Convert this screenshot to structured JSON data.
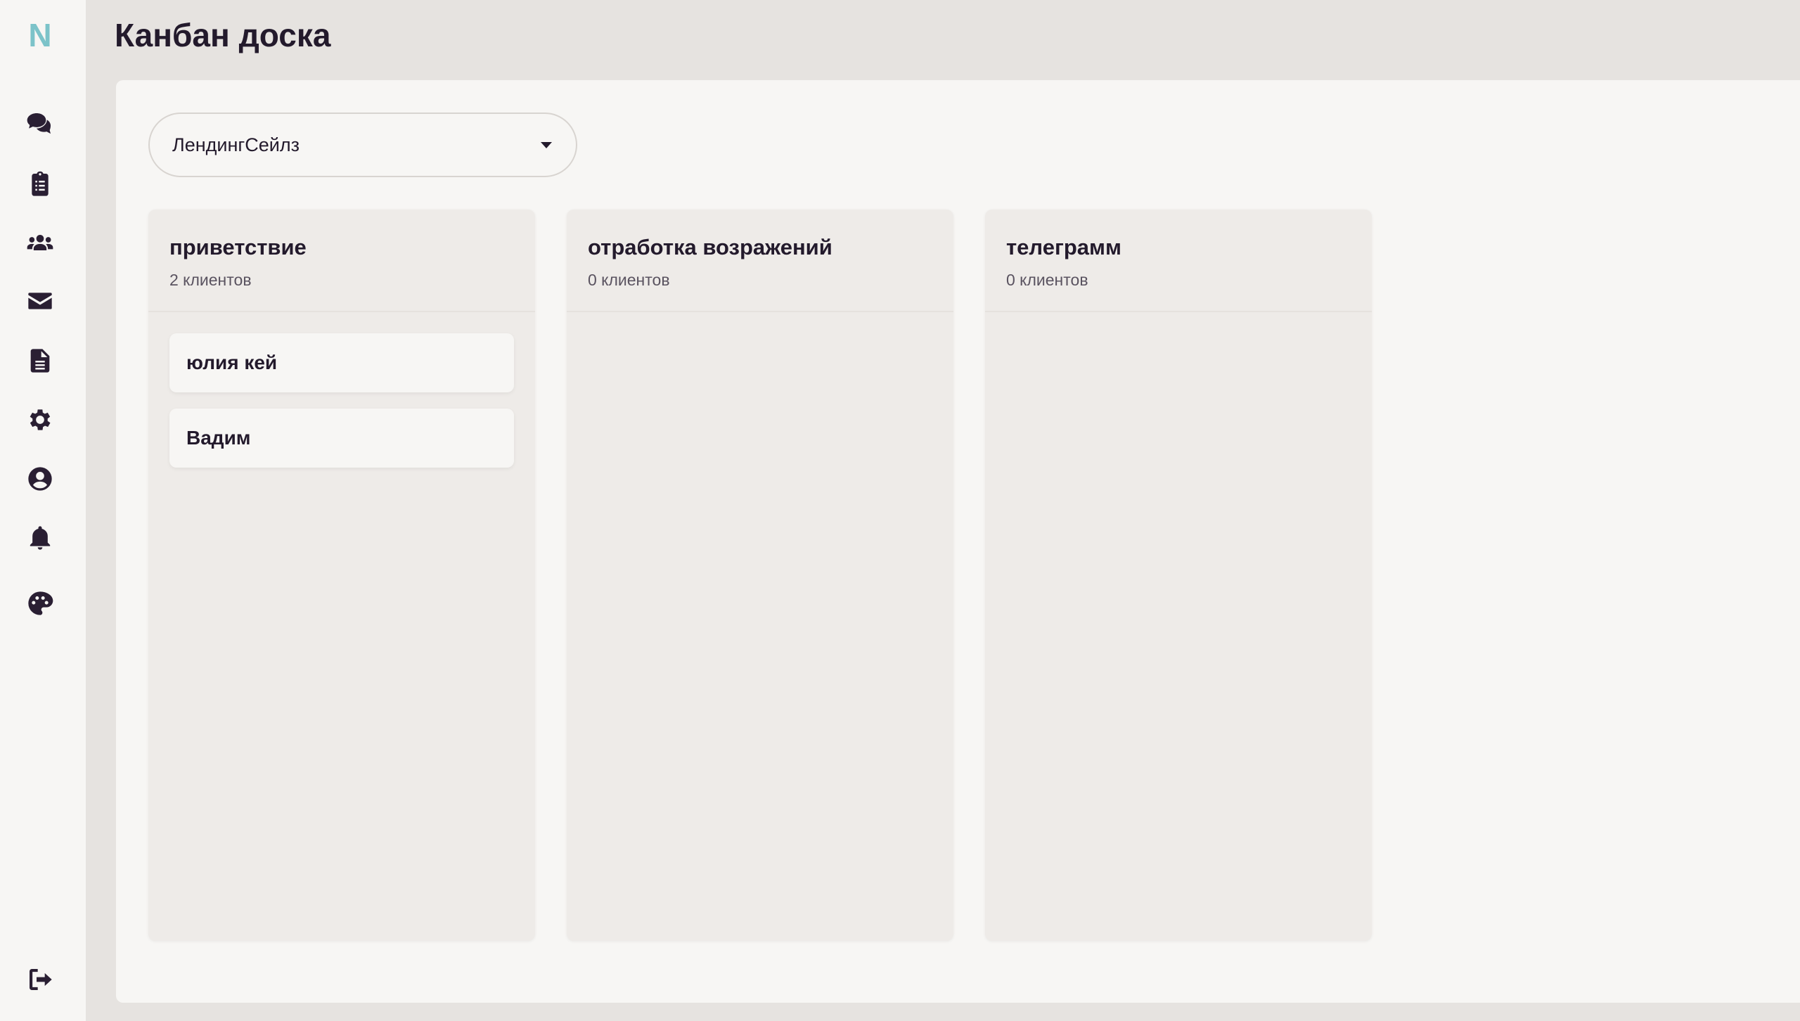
{
  "app": {
    "logo": "N",
    "accent": "#7cc3c9"
  },
  "sidebar": {
    "items": [
      {
        "icon": "chat-icon"
      },
      {
        "icon": "clipboard-list-icon"
      },
      {
        "icon": "users-icon"
      },
      {
        "icon": "mail-icon"
      },
      {
        "icon": "document-icon"
      },
      {
        "icon": "gear-icon"
      },
      {
        "icon": "user-circle-icon"
      },
      {
        "icon": "bell-icon"
      },
      {
        "icon": "palette-icon"
      }
    ],
    "logout_icon": "logout-icon"
  },
  "header": {
    "title": "Канбан доска"
  },
  "funnel_select": {
    "value": "ЛендингСейлз"
  },
  "columns": [
    {
      "title": "приветствие",
      "count": "2 клиентов",
      "cards": [
        {
          "name": "юлия кей"
        },
        {
          "name": "Вадим"
        }
      ]
    },
    {
      "title": "отработка возражений",
      "count": "0 клиентов",
      "cards": []
    },
    {
      "title": "телеграмм",
      "count": "0 клиентов",
      "cards": []
    }
  ]
}
